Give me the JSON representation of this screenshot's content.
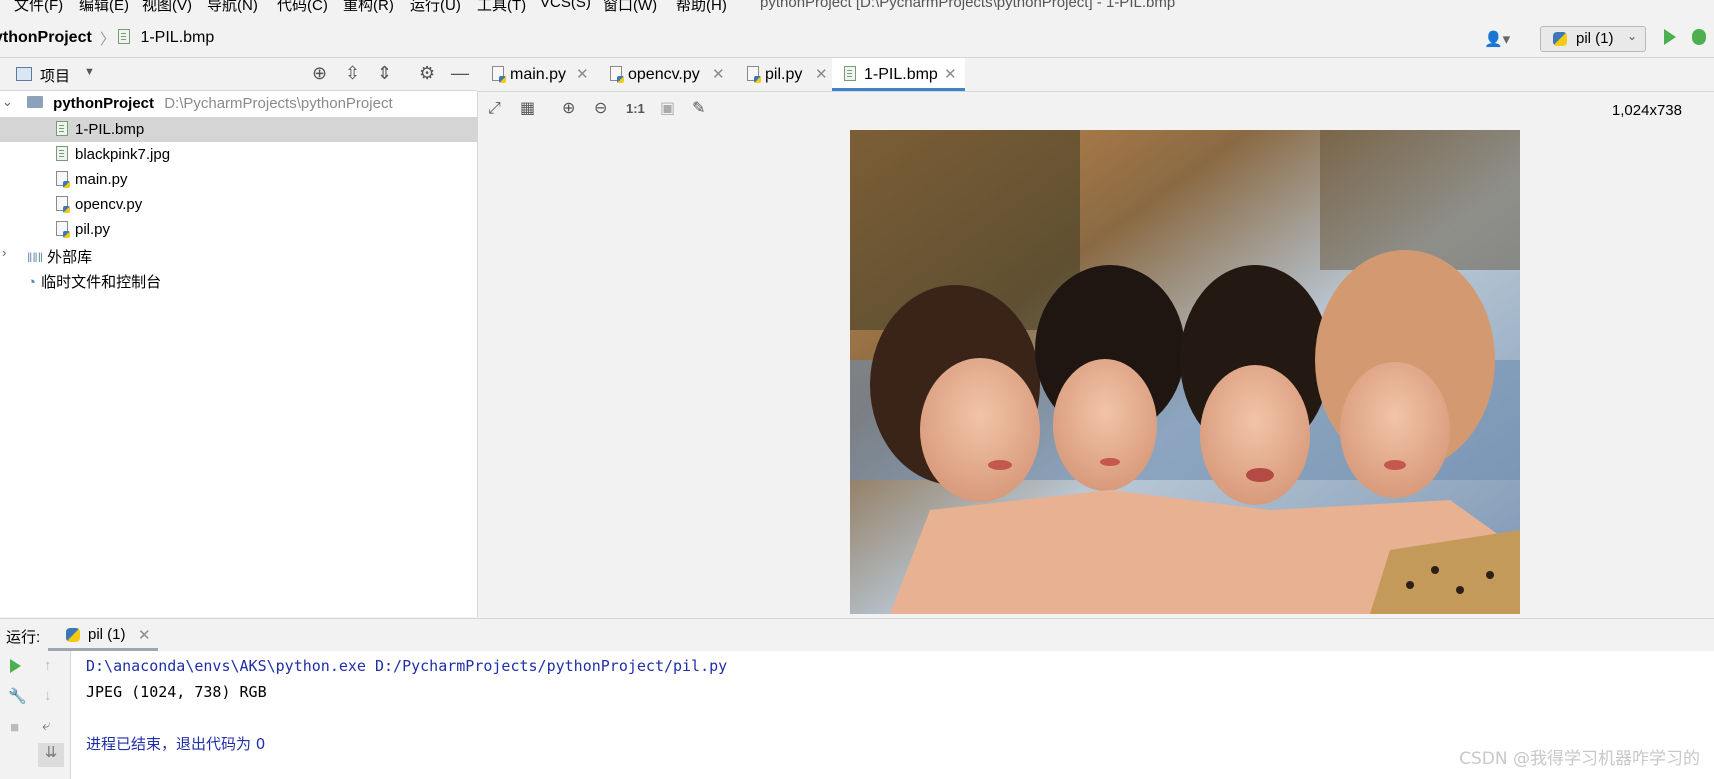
{
  "menu": [
    "文件(F)",
    "编辑(E)",
    "视图(V)",
    "导航(N)",
    "代码(C)",
    "重构(R)",
    "运行(U)",
    "工具(T)",
    "VCS(S)",
    "窗口(W)",
    "帮助(H)"
  ],
  "window_title": "pythonProject [D:\\PycharmProjects\\pythonProject] - 1-PIL.bmp",
  "breadcrumb": {
    "project": "ythonProject",
    "file": "1-PIL.bmp"
  },
  "run_config": {
    "label": "pil (1)"
  },
  "project_panel": {
    "title": "项目",
    "root": {
      "name": "pythonProject",
      "path": "D:\\PycharmProjects\\pythonProject"
    },
    "files": [
      "1-PIL.bmp",
      "blackpink7.jpg",
      "main.py",
      "opencv.py",
      "pil.py"
    ],
    "external_libs": "外部库",
    "scratches": "临时文件和控制台"
  },
  "tabs": [
    "main.py",
    "opencv.py",
    "pil.py",
    "1-PIL.bmp"
  ],
  "image_toolbar": {
    "zoom_actual": "1:1"
  },
  "image_viewer": {
    "dimensions": "1,024x738"
  },
  "run_panel": {
    "label": "运行:",
    "tab": "pil (1)",
    "lines": [
      "D:\\anaconda\\envs\\AKS\\python.exe D:/PycharmProjects/pythonProject/pil.py",
      "JPEG (1024, 738) RGB",
      "进程已结束，退出代码为 0"
    ]
  },
  "watermark": "CSDN @我得学习机器咋学习的",
  "colors": {
    "accent": "#4083c9",
    "run_green": "#4caf50",
    "console_blue": "#1f2fa8"
  }
}
